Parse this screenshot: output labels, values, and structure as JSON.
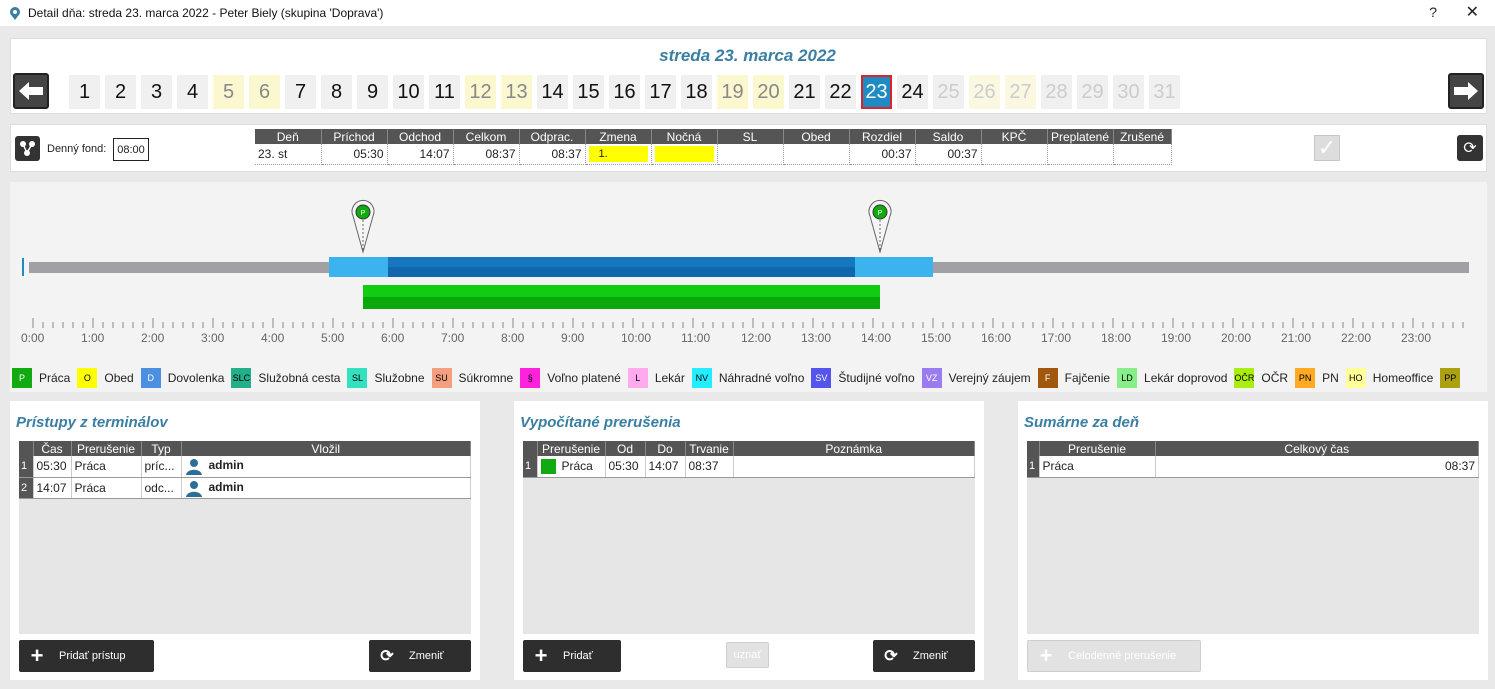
{
  "window": {
    "title": "Detail dňa: streda 23. marca 2022 -  Peter Biely  (skupina 'Doprava')",
    "help": "?",
    "close": "✕"
  },
  "date_title": "streda 23. marca 2022",
  "days": [
    {
      "n": "1",
      "state": "normal"
    },
    {
      "n": "2",
      "state": "normal"
    },
    {
      "n": "3",
      "state": "normal"
    },
    {
      "n": "4",
      "state": "normal"
    },
    {
      "n": "5",
      "state": "weekend"
    },
    {
      "n": "6",
      "state": "weekend"
    },
    {
      "n": "7",
      "state": "normal"
    },
    {
      "n": "8",
      "state": "normal"
    },
    {
      "n": "9",
      "state": "normal"
    },
    {
      "n": "10",
      "state": "normal"
    },
    {
      "n": "11",
      "state": "normal"
    },
    {
      "n": "12",
      "state": "weekend"
    },
    {
      "n": "13",
      "state": "weekend"
    },
    {
      "n": "14",
      "state": "normal"
    },
    {
      "n": "15",
      "state": "normal"
    },
    {
      "n": "16",
      "state": "normal"
    },
    {
      "n": "17",
      "state": "normal"
    },
    {
      "n": "18",
      "state": "normal"
    },
    {
      "n": "19",
      "state": "weekend"
    },
    {
      "n": "20",
      "state": "weekend"
    },
    {
      "n": "21",
      "state": "normal"
    },
    {
      "n": "22",
      "state": "normal"
    },
    {
      "n": "23",
      "state": "selected"
    },
    {
      "n": "24",
      "state": "normal"
    },
    {
      "n": "25",
      "state": "future"
    },
    {
      "n": "26",
      "state": "future weekend"
    },
    {
      "n": "27",
      "state": "future weekend"
    },
    {
      "n": "28",
      "state": "future"
    },
    {
      "n": "29",
      "state": "future"
    },
    {
      "n": "30",
      "state": "future"
    },
    {
      "n": "31",
      "state": "future"
    }
  ],
  "fond": {
    "label": "Denný fond:",
    "value": "08:00"
  },
  "summary": {
    "headers": [
      "Deň",
      "Príchod",
      "Odchod",
      "Celkom",
      "Odprac.",
      "Zmena",
      "Nočná",
      "SL",
      "Obed",
      "Rozdiel",
      "Saldo",
      "KPČ",
      "Preplatené",
      "Zrušené"
    ],
    "row": [
      "23. st",
      "05:30",
      "14:07",
      "08:37",
      "08:37",
      "1.",
      "",
      "",
      "",
      "00:37",
      "00:37",
      "",
      "",
      ""
    ]
  },
  "timeline": {
    "ticks": [
      "0:00",
      "1:00",
      "2:00",
      "3:00",
      "4:00",
      "5:00",
      "6:00",
      "7:00",
      "8:00",
      "9:00",
      "10:00",
      "11:00",
      "12:00",
      "13:00",
      "14:00",
      "15:00",
      "16:00",
      "17:00",
      "18:00",
      "19:00",
      "20:00",
      "21:00",
      "22:00",
      "23:00"
    ],
    "markers": [
      {
        "time": "05:30",
        "letter": "P"
      },
      {
        "time": "14:07",
        "letter": "P"
      }
    ],
    "work_bar": {
      "from": "05:30",
      "to": "14:07"
    }
  },
  "legend": [
    {
      "code": "P",
      "label": "Práca",
      "color": "#11aa11",
      "text": "#fff"
    },
    {
      "code": "O",
      "label": "Obed",
      "color": "#ffff00",
      "text": "#000"
    },
    {
      "code": "D",
      "label": "Dovolenka",
      "color": "#4a8fe0",
      "text": "#fff"
    },
    {
      "code": "SLC",
      "label": "Služobná cesta",
      "color": "#22b08a",
      "text": "#000"
    },
    {
      "code": "SL",
      "label": "Služobne",
      "color": "#33e0c0",
      "text": "#000"
    },
    {
      "code": "SU",
      "label": "Súkromne",
      "color": "#f4a080",
      "text": "#000"
    },
    {
      "code": "§",
      "label": "Voľno platené",
      "color": "#ff22dd",
      "text": "#000"
    },
    {
      "code": "L",
      "label": "Lekár",
      "color": "#ffaaee",
      "text": "#000"
    },
    {
      "code": "NV",
      "label": "Náhradné voľno",
      "color": "#22eeff",
      "text": "#000"
    },
    {
      "code": "SV",
      "label": "Študijné voľno",
      "color": "#5555ee",
      "text": "#fff"
    },
    {
      "code": "VZ",
      "label": "Verejný záujem",
      "color": "#9a7cf0",
      "text": "#fff"
    },
    {
      "code": "F",
      "label": "Fajčenie",
      "color": "#a0580f",
      "text": "#fff"
    },
    {
      "code": "LD",
      "label": "Lekár doprovod",
      "color": "#88ee88",
      "text": "#000"
    },
    {
      "code": "OČR",
      "label": "OČR",
      "color": "#aaee11",
      "text": "#000"
    },
    {
      "code": "PN",
      "label": "PN",
      "color": "#ffaa22",
      "text": "#000"
    },
    {
      "code": "HO",
      "label": "Homeoffice",
      "color": "#ffff99",
      "text": "#000"
    },
    {
      "code": "PP",
      "label": "",
      "color": "#aaa010",
      "text": "#000"
    }
  ],
  "access": {
    "title": "Prístupy z terminálov",
    "headers": [
      "",
      "Čas",
      "Prerušenie",
      "Typ",
      "Vložil"
    ],
    "rows": [
      {
        "n": "1",
        "cas": "05:30",
        "prer": "Práca",
        "typ": "príc...",
        "user": "admin"
      },
      {
        "n": "2",
        "cas": "14:07",
        "prer": "Práca",
        "typ": "odc...",
        "user": "admin"
      }
    ],
    "add_label": "Pridať prístup",
    "change_label": "Zmeniť"
  },
  "computed": {
    "title": "Vypočítané prerušenia",
    "headers": [
      "",
      "Prerušenie",
      "Od",
      "Do",
      "Trvanie",
      "Poznámka"
    ],
    "rows": [
      {
        "n": "1",
        "prer": "Práca",
        "od": "05:30",
        "do": "14:07",
        "trv": "08:37",
        "pozn": ""
      }
    ],
    "add_label": "Pridať",
    "accept_label": "uznať",
    "change_label": "Zmeniť"
  },
  "daily": {
    "title": "Sumárne za deň",
    "headers": [
      "",
      "Prerušenie",
      "Celkový čas"
    ],
    "rows": [
      {
        "n": "1",
        "prer": "Práca",
        "cas": "08:37"
      }
    ],
    "button_label": "Celodenné prerušenie"
  }
}
